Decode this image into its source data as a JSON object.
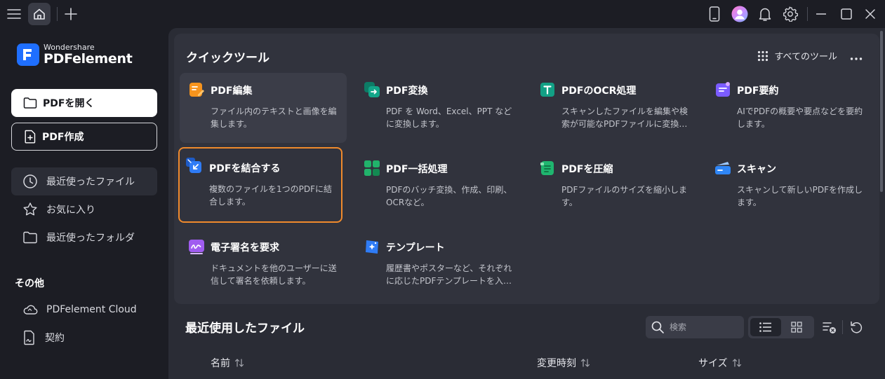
{
  "app": {
    "brand": "Wondershare",
    "product": "PDFelement"
  },
  "sidebar": {
    "open_label": "PDFを開く",
    "create_label": "PDF作成",
    "nav": [
      {
        "label": "最近使ったファイル"
      },
      {
        "label": "お気に入り"
      },
      {
        "label": "最近使ったフォルダ"
      }
    ],
    "other_label": "その他",
    "other": [
      {
        "label": "PDFelement Cloud"
      },
      {
        "label": "契約"
      }
    ]
  },
  "quick_tools": {
    "title": "クイックツール",
    "all_tools_label": "すべてのツール",
    "tools": [
      {
        "name": "PDF編集",
        "desc": "ファイル内のテキストと画像を編集します。",
        "color": "#f7941d"
      },
      {
        "name": "PDF変換",
        "desc": "PDF を Word、Excel、PPT などに変換します。",
        "color": "#13a689"
      },
      {
        "name": "PDFのOCR処理",
        "desc": "スキャンしたファイルを編集や検索が可能なPDFファイルに変換…",
        "color": "#12a085"
      },
      {
        "name": "PDF要約",
        "desc": "AIでPDFの概要や要点などを要約します。",
        "color": "#7b5cff"
      },
      {
        "name": "PDFを結合する",
        "desc": "複数のファイルを1つのPDFに結合します。",
        "color": "#2f7cf6"
      },
      {
        "name": "PDF一括処理",
        "desc": "PDFのバッチ変換、作成、印刷、OCRなど。",
        "color": "#21b36b"
      },
      {
        "name": "PDFを圧縮",
        "desc": "PDFファイルのサイズを縮小します。",
        "color": "#1fb56f"
      },
      {
        "name": "スキャン",
        "desc": "スキャンして新しいPDFを作成します。",
        "color": "#2f86f6"
      },
      {
        "name": "電子署名を要求",
        "desc": "ドキュメントを他のユーザーに送信して署名を依頼します。",
        "color": "#a05cf0"
      },
      {
        "name": "テンプレート",
        "desc": "履歴書やポスターなど、それぞれに応じたPDFテンプレートを入…",
        "color": "#2f7cf6"
      }
    ]
  },
  "recent": {
    "title": "最近使用したファイル",
    "search_placeholder": "検索",
    "columns": [
      "名前",
      "変更時刻",
      "サイズ"
    ]
  }
}
